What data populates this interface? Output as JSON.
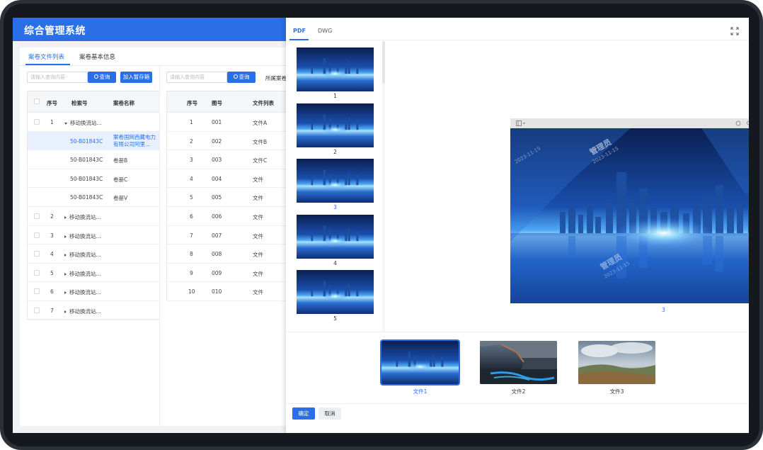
{
  "app": {
    "title": "综合管理系统"
  },
  "tabs": [
    {
      "label": "案卷文件列表",
      "active": true
    },
    {
      "label": "案卷基本信息",
      "active": false
    }
  ],
  "left_panel": {
    "search_placeholder": "请输入查询内容",
    "search_button": "查询",
    "add_button": "加入暂存箱",
    "columns": [
      "序号",
      "检索号",
      "案卷名称"
    ],
    "rows": [
      {
        "seq": "1",
        "code": "",
        "name": "移动换流站...",
        "expanded": true
      },
      {
        "seq": "",
        "code": "50-B01843C",
        "name": "案卷国网西藏电力有限公司阿里...",
        "selected": true,
        "name_line1": "案卷国网西藏电力",
        "name_line2": "有限公司阿里..."
      },
      {
        "seq": "",
        "code": "50-B01843C",
        "name": "卷册B"
      },
      {
        "seq": "",
        "code": "50-B01843C",
        "name": "卷册C"
      },
      {
        "seq": "",
        "code": "50-B01843C",
        "name": "卷册V"
      },
      {
        "seq": "2",
        "code": "",
        "name": "移动换流站..."
      },
      {
        "seq": "3",
        "code": "",
        "name": "移动换流站..."
      },
      {
        "seq": "4",
        "code": "",
        "name": "移动换流站..."
      },
      {
        "seq": "5",
        "code": "",
        "name": "移动换流站..."
      },
      {
        "seq": "6",
        "code": "",
        "name": "移动换流站..."
      },
      {
        "seq": "7",
        "code": "",
        "name": "移动换流站..."
      }
    ]
  },
  "middle_panel": {
    "search_placeholder": "请输入查询内容",
    "search_button": "查询",
    "filter_label": "所属案卷",
    "columns": [
      "序号",
      "图号",
      "文件列表"
    ],
    "rows": [
      {
        "seq": "1",
        "num": "001",
        "file": "文件A"
      },
      {
        "seq": "2",
        "num": "002",
        "file": "文件B"
      },
      {
        "seq": "3",
        "num": "003",
        "file": "文件C"
      },
      {
        "seq": "4",
        "num": "004",
        "file": "文件"
      },
      {
        "seq": "5",
        "num": "005",
        "file": "文件"
      },
      {
        "seq": "6",
        "num": "006",
        "file": "文件"
      },
      {
        "seq": "7",
        "num": "007",
        "file": "文件"
      },
      {
        "seq": "8",
        "num": "008",
        "file": "文件"
      },
      {
        "seq": "9",
        "num": "009",
        "file": "文件"
      },
      {
        "seq": "10",
        "num": "010",
        "file": "文件"
      }
    ]
  },
  "preview": {
    "tabs": [
      {
        "label": "PDF",
        "active": true
      },
      {
        "label": "DWG",
        "active": false
      }
    ],
    "thumbnails": [
      "1",
      "2",
      "3",
      "4",
      "5"
    ],
    "active_thumbnail": "3",
    "current_page": "3",
    "watermark": {
      "line1": "管理员",
      "line2": "2023-11-15"
    },
    "files": [
      {
        "label": "文件1",
        "active": true
      },
      {
        "label": "文件2",
        "active": false
      },
      {
        "label": "文件3",
        "active": false
      }
    ],
    "confirm_button": "确定",
    "cancel_button": "取消"
  },
  "colors": {
    "accent": "#2b6fe6"
  },
  "icons": [
    "search-icon",
    "expand-icon",
    "caret-right-icon",
    "caret-down-icon",
    "sidebar-toggle-icon",
    "zoom-in-icon",
    "zoom-out-icon",
    "rotate-icon",
    "print-icon",
    "download-icon",
    "close-icon"
  ]
}
